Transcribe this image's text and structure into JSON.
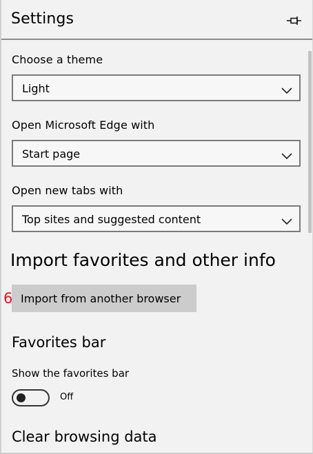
{
  "panel": {
    "title": "Settings",
    "pin_icon": "pin-icon"
  },
  "theme": {
    "label": "Choose a theme",
    "value": "Light"
  },
  "startup": {
    "label": "Open Microsoft Edge with",
    "value": "Start page"
  },
  "new_tabs": {
    "label": "Open new tabs with",
    "value": "Top sites and suggested content"
  },
  "import": {
    "heading": "Import favorites and other info",
    "marker": "6",
    "button_label": "Import from another browser"
  },
  "favorites_bar": {
    "heading": "Favorites bar",
    "label": "Show the favorites bar",
    "toggle_state": "Off",
    "enabled": false
  },
  "clear_data": {
    "heading": "Clear browsing data"
  },
  "colors": {
    "background": "#f2f2f2",
    "button": "#cccccc",
    "marker": "#e81123",
    "border": "#7a7a7a"
  }
}
